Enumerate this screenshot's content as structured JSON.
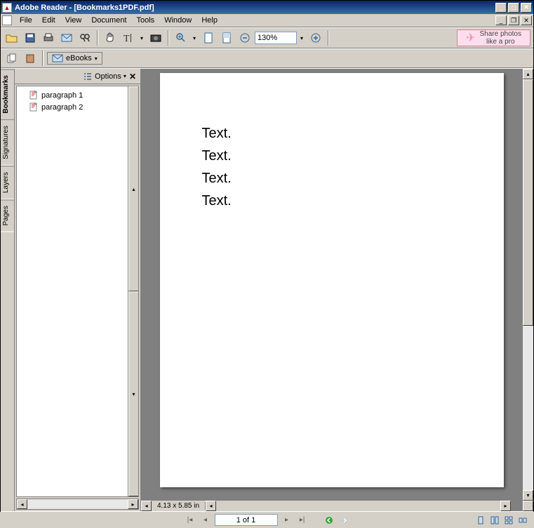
{
  "titlebar": {
    "app_name": "Adobe Reader",
    "doc_name": "[Bookmarks1PDF.pdf]"
  },
  "menu": {
    "items": [
      "File",
      "Edit",
      "View",
      "Document",
      "Tools",
      "Window",
      "Help"
    ]
  },
  "toolbar": {
    "zoom_value": "130%",
    "ebooks_label": "eBooks",
    "promo_line1": "Share photos",
    "promo_line2": "like a pro"
  },
  "side_tabs": [
    "Bookmarks",
    "Signatures",
    "Layers",
    "Pages"
  ],
  "bookmarks": {
    "options_label": "Options",
    "items": [
      {
        "label": "paragraph 1"
      },
      {
        "label": "paragraph 2"
      }
    ]
  },
  "document": {
    "lines": [
      "Text.",
      "Text.",
      "Text.",
      "Text."
    ],
    "size_label": "4.13 x 5.85 in"
  },
  "status": {
    "page_indicator": "1 of 1"
  }
}
